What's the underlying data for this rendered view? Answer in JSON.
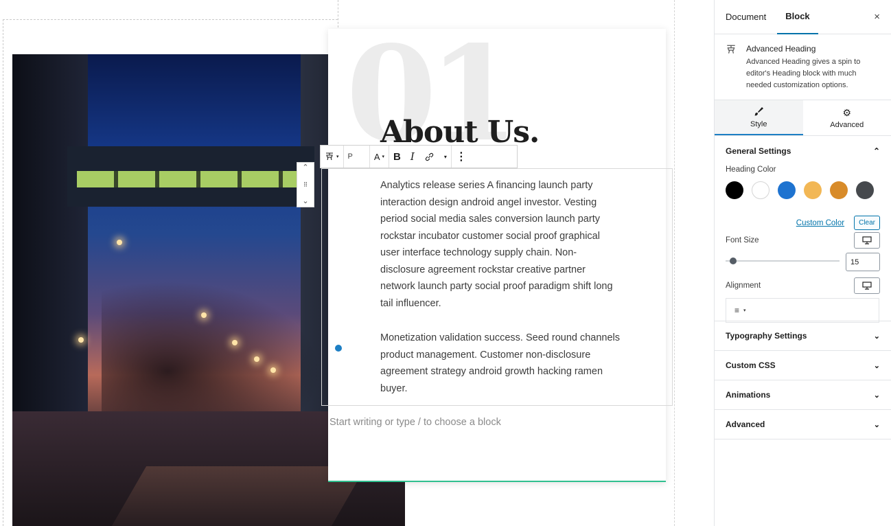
{
  "canvas": {
    "bg_number": "01",
    "heading": "About Us.",
    "paragraph1": "Analytics release series A financing launch party interaction design android angel investor. Vesting period social media sales conversion launch party rockstar incubator customer social proof graphical user interface technology supply chain. Non-disclosure agreement rockstar creative partner network launch party social proof paradigm shift long tail influencer.",
    "paragraph2": "Monetization validation success. Seed round channels product management. Customer non-disclosure agreement strategy android growth hacking ramen buyer.",
    "placeholder": "Start writing or type / to choose a block",
    "accent_line_color": "#2fbf8f"
  },
  "toolbar": {
    "block_icon": "advanced-heading-icon",
    "paragraph_tag": "P",
    "text_color_label": "A",
    "bold_label": "B",
    "italic_label": "I",
    "link_icon": "link-icon",
    "more_caret": "▾",
    "options_icon": "⋮"
  },
  "movers": {
    "up": "⌃",
    "drag": "⠿",
    "down": "⌄"
  },
  "sidebar": {
    "tabs": [
      "Document",
      "Block"
    ],
    "active_tab": "Block",
    "close": "×",
    "block_title": "Advanced Heading",
    "block_desc": "Advanced Heading gives a spin to editor's Heading block with much needed customization options.",
    "panel_tabs": [
      {
        "label": "Style",
        "icon": "brush-icon"
      },
      {
        "label": "Advanced",
        "icon": "gear-icon"
      }
    ],
    "general": {
      "title": "General Settings",
      "heading_color_label": "Heading Color",
      "colors": [
        "#000000",
        "#ffffff",
        "#1e73d0",
        "#f2b755",
        "#d88b29",
        "#46494d"
      ],
      "custom_color": "Custom Color",
      "clear": "Clear",
      "font_size_label": "Font Size",
      "font_size_value": "15",
      "alignment_label": "Alignment",
      "alignment_icon": "≡"
    },
    "sections": [
      "Typography Settings",
      "Custom CSS",
      "Animations",
      "Advanced"
    ],
    "accent_color": "#0073aa"
  }
}
